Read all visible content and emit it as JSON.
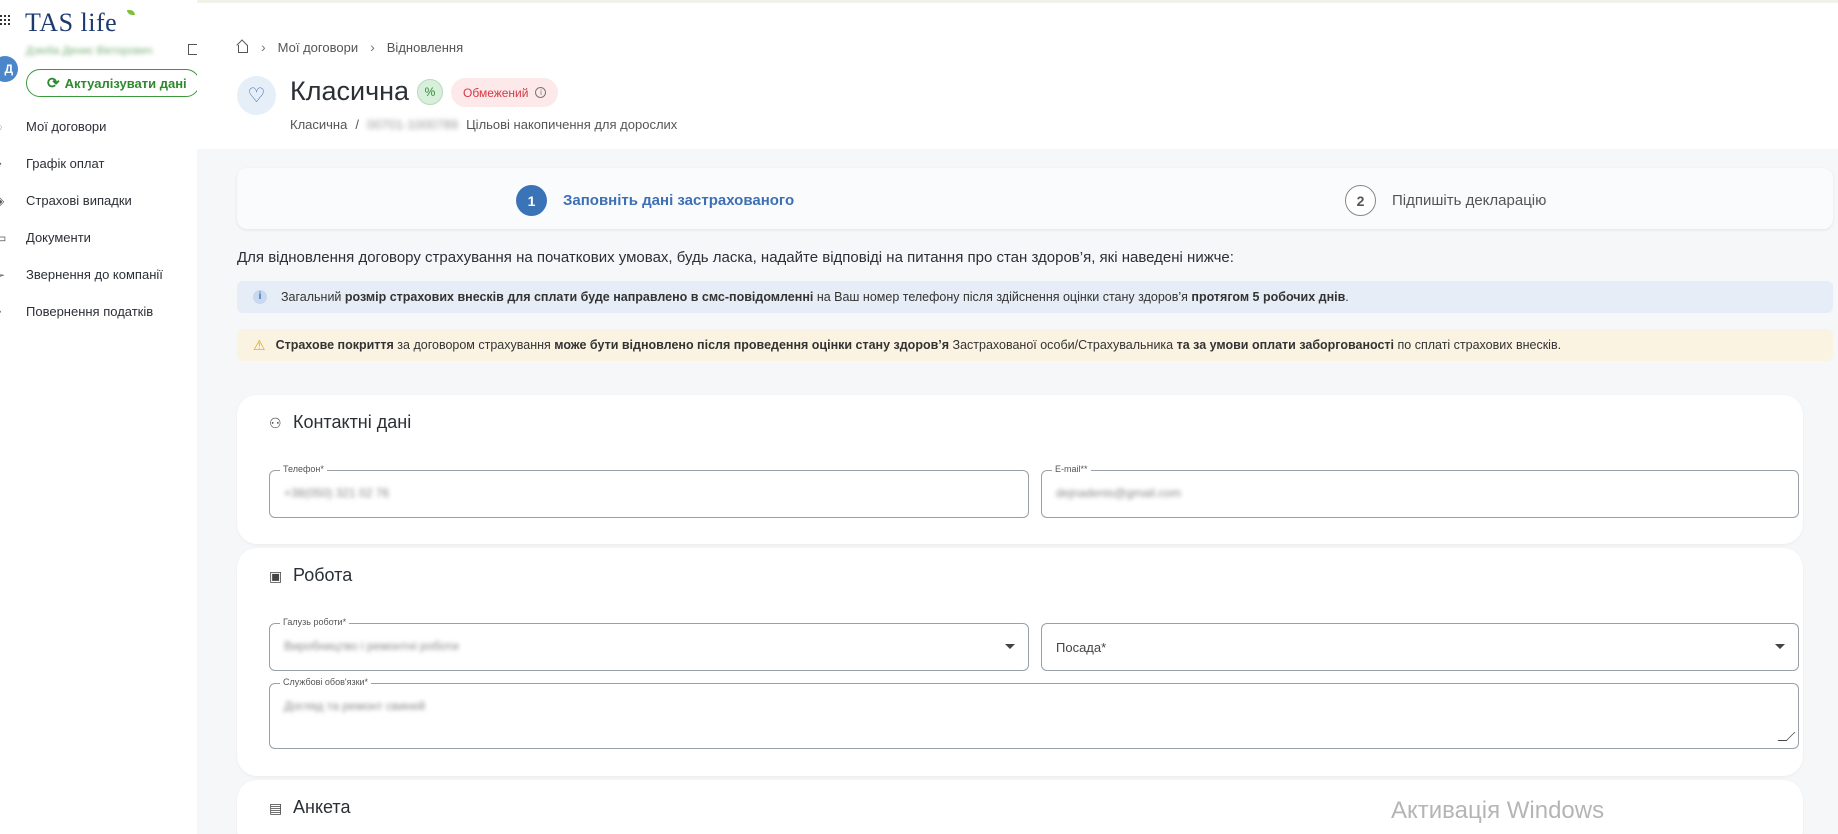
{
  "app": {
    "logo_text": "TAS life",
    "avatar_initial": "Д",
    "user_name": "Дзюба Денис Вікторович",
    "refresh_button": "Актуалізувати дані"
  },
  "sidebar": {
    "items": [
      {
        "label": "Мої договори",
        "icon": "shield-check-icon"
      },
      {
        "label": "Графік оплат",
        "icon": "payment-schedule-icon"
      },
      {
        "label": "Страхові випадки",
        "icon": "insurance-case-icon"
      },
      {
        "label": "Документи",
        "icon": "document-icon"
      },
      {
        "label": "Звернення до компанії",
        "icon": "send-icon"
      },
      {
        "label": "Повернення податків",
        "icon": "tax-return-icon"
      }
    ]
  },
  "breadcrumb": {
    "items": [
      "Мої договори",
      "Відновлення"
    ]
  },
  "product": {
    "title": "Класична",
    "status_badge": "Обмежений",
    "sub_name": "Класична",
    "sub_slash": "/",
    "contract_number": "00701-1000789",
    "sub_program": "Цільові накопичення для дорослих"
  },
  "stepper": {
    "steps": [
      {
        "number": "1",
        "label": "Заповніть дані застрахованого",
        "active": true
      },
      {
        "number": "2",
        "label": "Підпишіть декларацію",
        "active": false
      }
    ]
  },
  "intro": "Для відновлення договору страхування на початкових умовах, будь ласка, надайте відповіді на питання про стан здоров’я, які наведені нижче:",
  "info_note": {
    "p1": "Загальний ",
    "b1": "розмір страхових внесків для сплати буде направлено в смс-повідомленні",
    "p2": " на Ваш номер телефону після здійснення оцінки стану здоров’я ",
    "b2": "протягом 5 робочих днів",
    "p3": "."
  },
  "warn_note": {
    "b1": "Страхове покриття",
    "p1": " за договором страхування ",
    "b2": "може бути відновлено після проведення оцінки стану здоров’я",
    "p2": " Застрахованої особи/Страхувальника ",
    "b3": "та за умови оплати заборгованості",
    "p3": " по сплаті страхових внесків."
  },
  "contacts": {
    "title": "Контактні дані",
    "phone_label": "Телефон*",
    "phone_value": "+38(050) 321 02 76",
    "email_label": "E-mail**",
    "email_value": "dejnadenis@gmail.com"
  },
  "work": {
    "title": "Робота",
    "industry_label": "Галузь роботи*",
    "industry_value": "Виробництво і ремонтні роботи",
    "position_placeholder": "Посада*",
    "duties_label": "Службові обов'язки*",
    "duties_value": "Догляд та ремонт свиней"
  },
  "survey": {
    "title": "Анкета"
  },
  "watermark": "Активація Windows",
  "colors": {
    "accent": "#3a74b6",
    "success": "#2e8a2e",
    "danger": "#d23a47",
    "warning": "#e0a21a"
  }
}
